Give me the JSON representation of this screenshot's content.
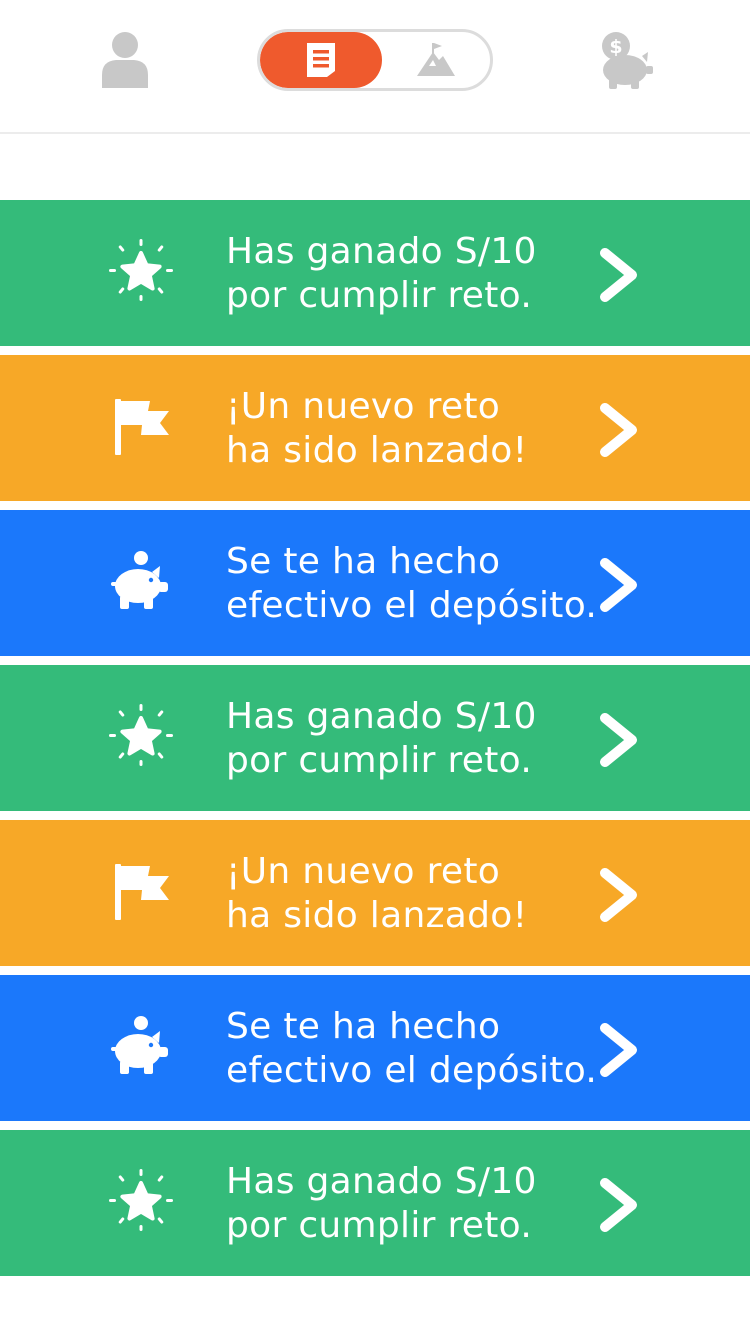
{
  "colors": {
    "accent": "#ef5a2d",
    "nav_icon": "#c8c8c8",
    "green": "#34bb7a",
    "orange": "#f7a827",
    "blue": "#1b78fb"
  },
  "nav": {
    "profile_icon": "user-icon",
    "savings_icon": "piggy-bank-dollar-icon",
    "toggle": {
      "active": "list",
      "left_icon": "document-list-icon",
      "right_icon": "mountain-flag-icon"
    }
  },
  "notifications": [
    {
      "type": "reward",
      "color": "green",
      "icon": "star-icon",
      "line1": "Has ganado S/10",
      "line2": "por cumplir reto."
    },
    {
      "type": "challenge",
      "color": "orange",
      "icon": "flag-icon",
      "line1": "¡Un nuevo reto",
      "line2": "ha sido lanzado!"
    },
    {
      "type": "deposit",
      "color": "blue",
      "icon": "piggy-bank-icon",
      "line1": "Se te ha hecho",
      "line2": "efectivo el depósito."
    },
    {
      "type": "reward",
      "color": "green",
      "icon": "star-icon",
      "line1": "Has ganado S/10",
      "line2": "por cumplir reto."
    },
    {
      "type": "challenge",
      "color": "orange",
      "icon": "flag-icon",
      "line1": "¡Un nuevo reto",
      "line2": "ha sido lanzado!"
    },
    {
      "type": "deposit",
      "color": "blue",
      "icon": "piggy-bank-icon",
      "line1": "Se te ha hecho",
      "line2": "efectivo el depósito."
    },
    {
      "type": "reward",
      "color": "green",
      "icon": "star-icon",
      "line1": "Has ganado S/10",
      "line2": "por cumplir reto."
    }
  ]
}
